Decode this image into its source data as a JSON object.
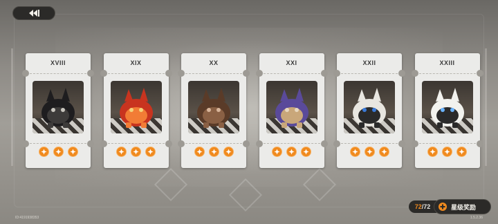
{
  "colors": {
    "accent": "#f08a1e",
    "card": "#ebebe9",
    "dark_button": "#2b2a28"
  },
  "back_button": {
    "icon": "back-arrow-icon"
  },
  "cards": [
    {
      "numeral": "XVIII",
      "art": "black-armored-dragon-character",
      "stars": 3
    },
    {
      "numeral": "XIX",
      "art": "flaming-boar-character",
      "stars": 3
    },
    {
      "numeral": "XX",
      "art": "brown-furry-beast-character",
      "stars": 3
    },
    {
      "numeral": "XXI",
      "art": "purple-haired-bandaged-creature",
      "stars": 3
    },
    {
      "numeral": "XXII",
      "art": "white-spiky-beast-character",
      "stars": 3
    },
    {
      "numeral": "XXIII",
      "art": "white-horned-sheep-character",
      "stars": 3
    }
  ],
  "footer": {
    "player_id": "ID:4191938353",
    "version": "1.5.2.36",
    "progress_current": "72",
    "progress_separator": "/",
    "progress_total": "72",
    "reward_button_label": "星级奖励",
    "reward_icon": "star-plus-icon"
  }
}
